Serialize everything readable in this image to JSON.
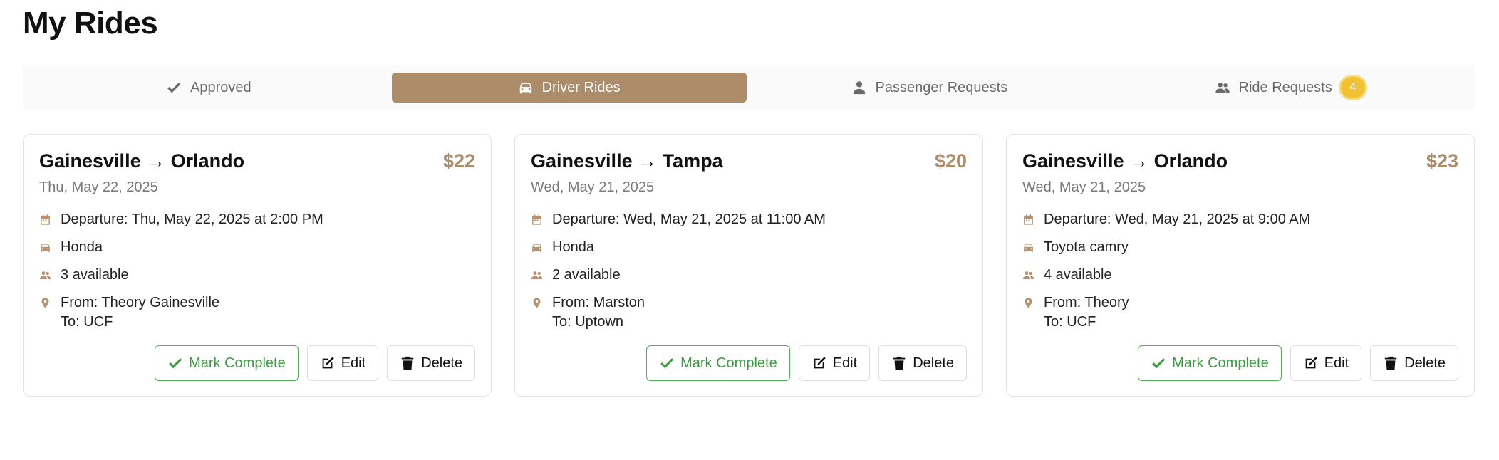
{
  "page": {
    "title": "My Rides"
  },
  "tabs": [
    {
      "label": "Approved",
      "icon": "check-icon",
      "active": false
    },
    {
      "label": "Driver Rides",
      "icon": "car-icon",
      "active": true
    },
    {
      "label": "Passenger Requests",
      "icon": "user-icon",
      "active": false
    },
    {
      "label": "Ride Requests",
      "icon": "users-icon",
      "active": false,
      "badge": "4"
    }
  ],
  "colors": {
    "accent": "#ad8c6a",
    "badge": "#f1c232",
    "complete": "#3c9c40"
  },
  "cards": [
    {
      "title": "Gainesville → Orlando",
      "price": "$22",
      "date": "Thu, May 22, 2025",
      "departure": "Departure: Thu, May 22, 2025 at 2:00 PM",
      "vehicle": "Honda",
      "seats": "3 available",
      "from": "From: Theory Gainesville",
      "to": "To: UCF"
    },
    {
      "title": "Gainesville → Tampa",
      "price": "$20",
      "date": "Wed, May 21, 2025",
      "departure": "Departure: Wed, May 21, 2025 at 11:00 AM",
      "vehicle": "Honda",
      "seats": "2 available",
      "from": "From: Marston",
      "to": "To: Uptown"
    },
    {
      "title": "Gainesville → Orlando",
      "price": "$23",
      "date": "Wed, May 21, 2025",
      "departure": "Departure: Wed, May 21, 2025 at 9:00 AM",
      "vehicle": "Toyota camry",
      "seats": "4 available",
      "from": "From: Theory",
      "to": "To: UCF"
    }
  ],
  "actions": {
    "complete_label": "Mark Complete",
    "edit_label": "Edit",
    "delete_label": "Delete"
  }
}
